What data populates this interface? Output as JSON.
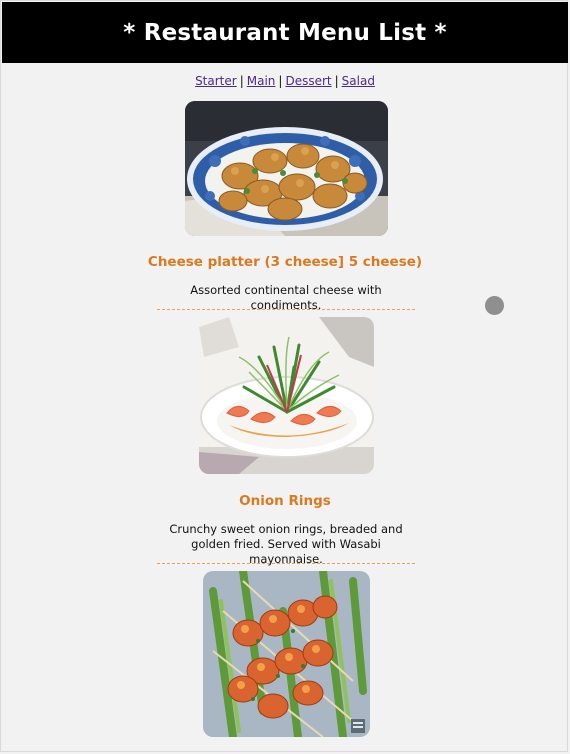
{
  "header": {
    "title": "* Restaurant Menu List *"
  },
  "nav": {
    "items": [
      "Starter",
      "Main",
      "Dessert",
      "Salad"
    ],
    "separator": "|"
  },
  "dishes": [
    {
      "name": "Cheese platter (3 cheese] 5 cheese)",
      "description": "Assorted continental cheese with condiments.",
      "image_icon": "fried-croquettes-photo"
    },
    {
      "name": "Onion Rings",
      "description": "Crunchy sweet onion rings, breaded and golden fried. Served with Wasabi mayonnaise.",
      "image_icon": "prawn-salad-photo"
    },
    {
      "name": "",
      "description": "",
      "image_icon": "prawn-skewers-photo"
    }
  ],
  "colors": {
    "header_bg": "#000000",
    "page_bg": "#f2f2f2",
    "title_accent": "#d97a1e",
    "link": "#4b2a8a",
    "divider": "#e8a35a"
  }
}
